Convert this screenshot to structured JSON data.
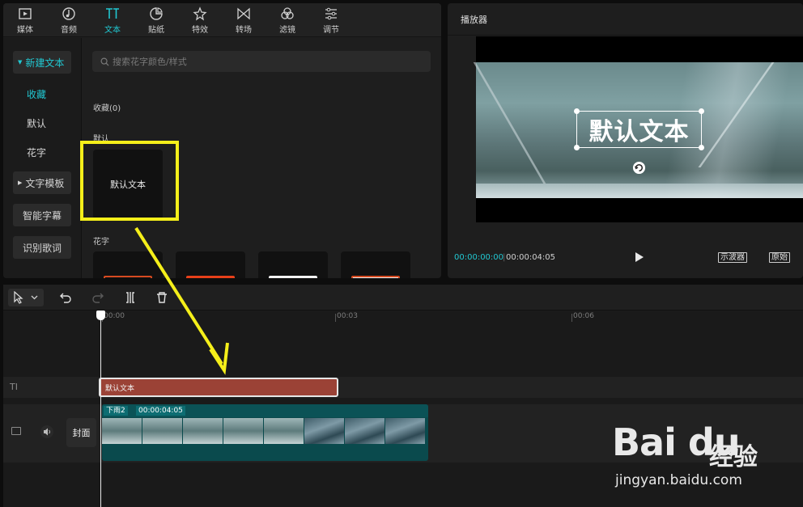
{
  "toolbar": {
    "items": [
      {
        "label": "媒体",
        "icon": "media-icon"
      },
      {
        "label": "音频",
        "icon": "audio-icon"
      },
      {
        "label": "文本",
        "icon": "text-icon"
      },
      {
        "label": "贴纸",
        "icon": "sticker-icon"
      },
      {
        "label": "特效",
        "icon": "effects-icon"
      },
      {
        "label": "转场",
        "icon": "transition-icon"
      },
      {
        "label": "滤镜",
        "icon": "filter-icon"
      },
      {
        "label": "调节",
        "icon": "adjust-icon"
      }
    ],
    "active": "文本",
    "accent_color": "#21c8d2"
  },
  "sidebar": {
    "items": [
      {
        "label": "新建文本",
        "expandable": true,
        "active": true
      },
      {
        "label": "收藏"
      },
      {
        "label": "默认"
      },
      {
        "label": "花字"
      },
      {
        "label": "文字模板",
        "expandable": true
      },
      {
        "label": "智能字幕"
      },
      {
        "label": "识别歌词"
      }
    ]
  },
  "content": {
    "search_placeholder": "搜索花字颜色/样式",
    "favorites_label": "收藏(0)",
    "default_label": "默认",
    "default_card_text": "默认文本",
    "huazi_label": "花字"
  },
  "player": {
    "title": "播放器",
    "overlay_text": "默认文本",
    "time_current": "00:00:00:00",
    "time_total": "00:00:04:05",
    "scope_label": "示波器",
    "original_label": "原始"
  },
  "timeline": {
    "ruler_labels": [
      "00:00",
      "00:03",
      "00:06"
    ],
    "text_clip_label": "默认文本",
    "video_clip_name": "下雨2",
    "video_clip_duration": "00:00:04:05",
    "cover_label": "封面",
    "text_track_icon": "TI"
  },
  "watermark": {
    "logo": "Bai du",
    "text": "经验",
    "url": "jingyan.baidu.com"
  },
  "colors": {
    "highlight": "#f5ef1a",
    "text_clip": "#9b4236",
    "video_clip": "#0a4a4d"
  }
}
